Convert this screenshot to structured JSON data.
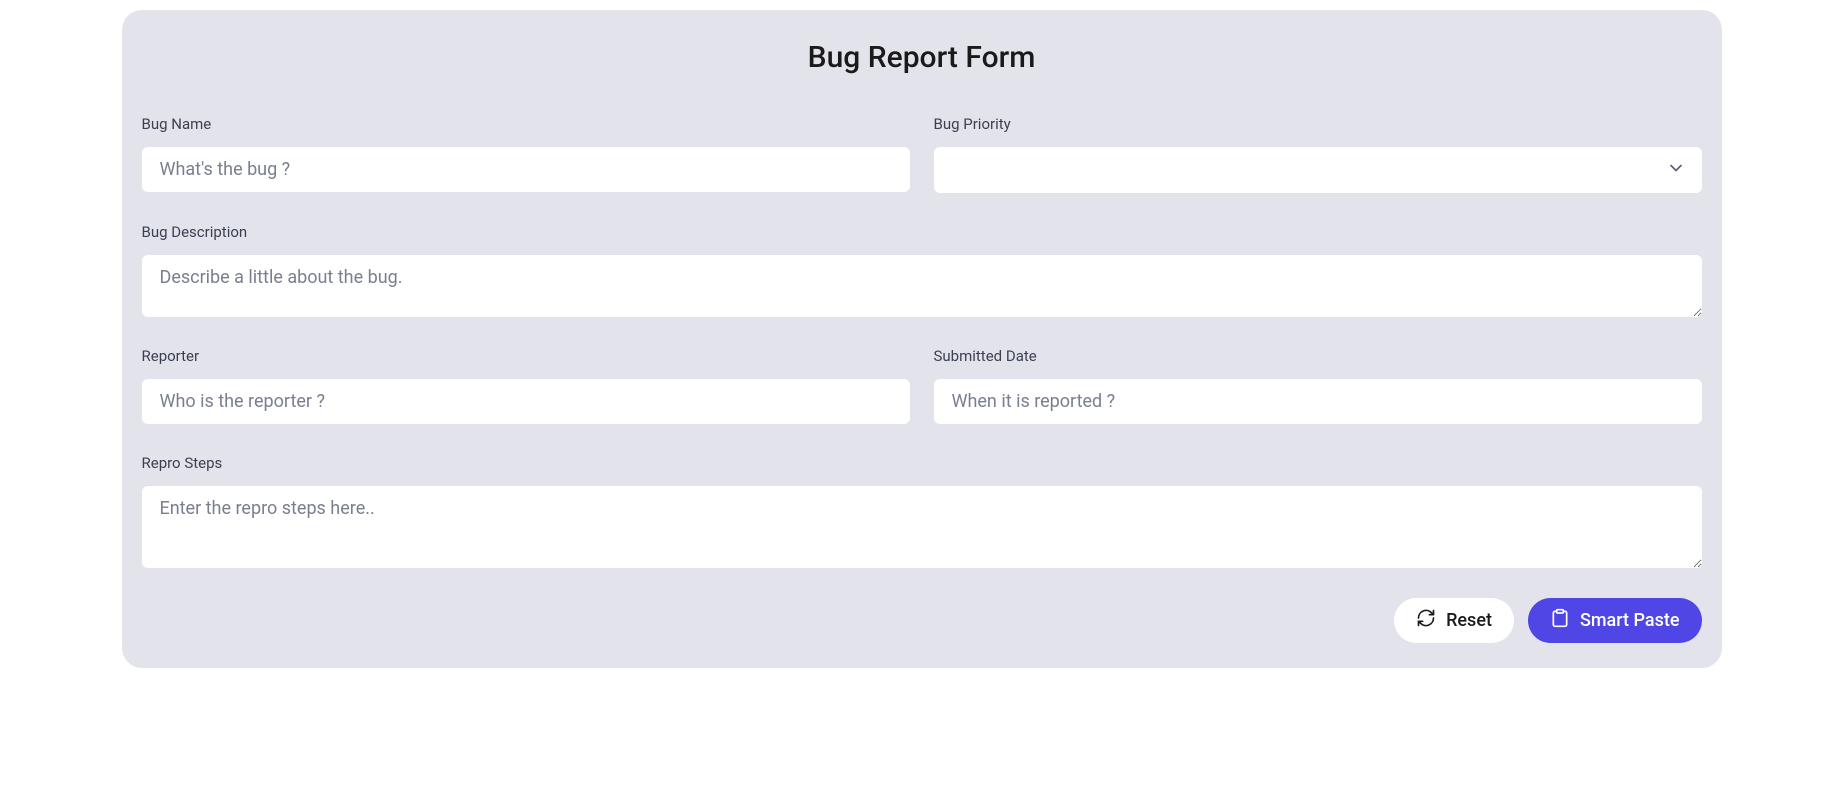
{
  "form": {
    "title": "Bug Report Form",
    "fields": {
      "bug_name": {
        "label": "Bug Name",
        "placeholder": "What's the bug ?",
        "value": ""
      },
      "bug_priority": {
        "label": "Bug Priority",
        "value": ""
      },
      "bug_description": {
        "label": "Bug Description",
        "placeholder": "Describe a little about the bug.",
        "value": ""
      },
      "reporter": {
        "label": "Reporter",
        "placeholder": "Who is the reporter ?",
        "value": ""
      },
      "submitted_date": {
        "label": "Submitted Date",
        "placeholder": "When it is reported ?",
        "value": ""
      },
      "repro_steps": {
        "label": "Repro Steps",
        "placeholder": "Enter the repro steps here..",
        "value": ""
      }
    },
    "buttons": {
      "reset": "Reset",
      "smart_paste": "Smart Paste"
    }
  }
}
